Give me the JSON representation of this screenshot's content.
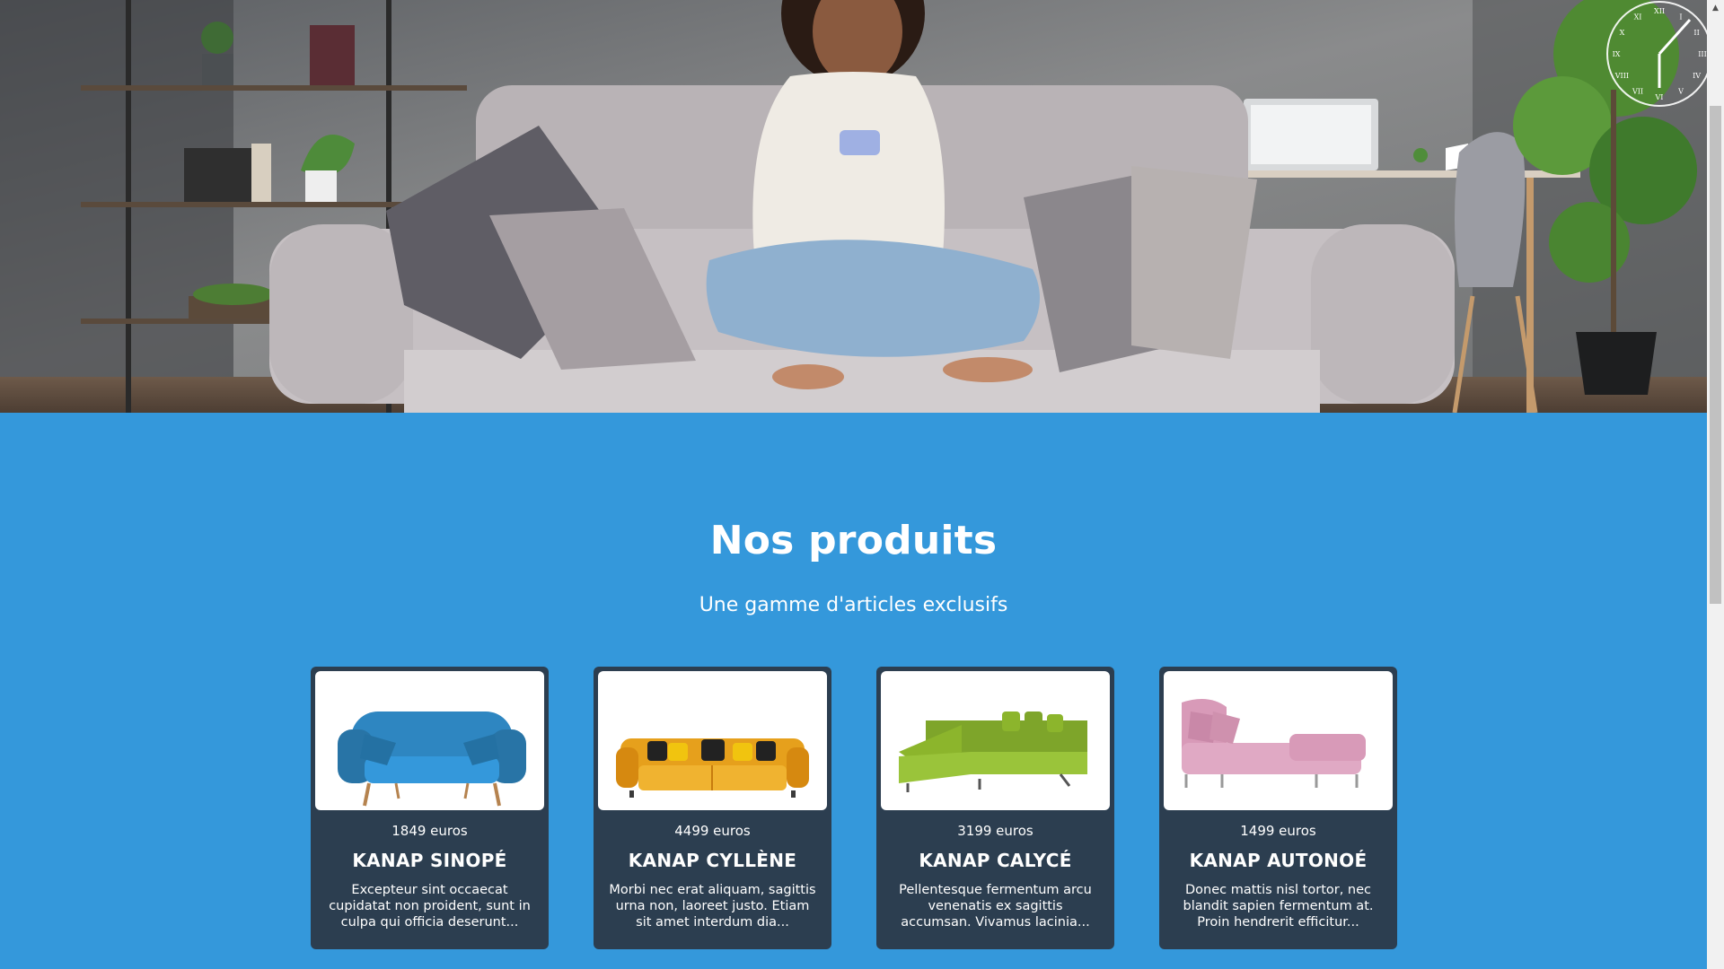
{
  "hero": {
    "image_alt": "Woman sitting on a sofa looking at her phone",
    "clock_numerals": [
      "XII",
      "I",
      "II",
      "III",
      "IV",
      "V",
      "VI",
      "VII",
      "VIII",
      "IX",
      "X",
      "XI"
    ]
  },
  "products_section": {
    "title": "Nos produits",
    "subtitle": "Une gamme d'articles exclusifs",
    "background_color": "#3498db",
    "card_color": "#2c3e50"
  },
  "products": [
    {
      "price": "1849 euros",
      "name": "KANAP SINOPÉ",
      "description": "Excepteur sint occaecat cupidatat non proident, sunt in culpa qui officia deserunt...",
      "sofa_color": "#2e86c1"
    },
    {
      "price": "4499 euros",
      "name": "KANAP CYLLÈNE",
      "description": "Morbi nec erat aliquam, sagittis urna non, laoreet justo. Etiam sit amet interdum dia...",
      "sofa_color": "#e6a01c"
    },
    {
      "price": "3199 euros",
      "name": "KANAP CALYCÉ",
      "description": "Pellentesque fermentum arcu venenatis ex sagittis accumsan. Vivamus lacinia...",
      "sofa_color": "#8cb52c"
    },
    {
      "price": "1499 euros",
      "name": "KANAP AUTONOÉ",
      "description": "Donec mattis nisl tortor, nec blandit sapien fermentum at. Proin hendrerit efficitur...",
      "sofa_color": "#d89ab8"
    }
  ]
}
